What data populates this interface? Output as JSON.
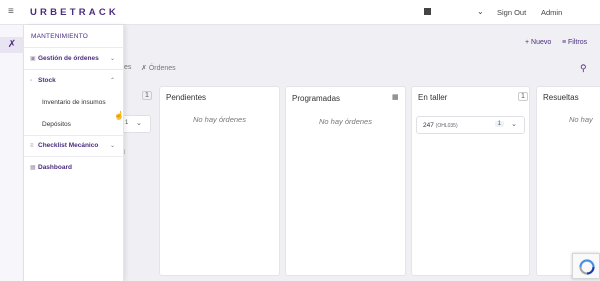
{
  "app": {
    "brand": "URBETRACK",
    "sign_out": "Sign Out",
    "user": "Admin"
  },
  "menu": {
    "header": "MANTENIMIENTO",
    "items": [
      {
        "label": "Gestión de órdenes",
        "icon": "truck-icon"
      },
      {
        "label": "Stock",
        "icon": "box-icon"
      },
      {
        "label": "Checklist Mecánico",
        "icon": "list-icon"
      },
      {
        "label": "Dashboard",
        "icon": "dashboard-icon"
      }
    ],
    "stock_sub": [
      "Inventario de insumos",
      "Depósitos"
    ]
  },
  "toolbar": {
    "nuevo": "Nuevo",
    "filtros": "Filtros",
    "tab_partial": "es",
    "tab_ordenes": "Órdenes"
  },
  "columns": {
    "partial_count": "1",
    "partial_badge": "1",
    "partial_mark": "l",
    "pendientes": {
      "title": "Pendientes",
      "empty": "No hay órdenes"
    },
    "programadas": {
      "title": "Programadas",
      "empty": "No hay órdenes"
    },
    "en_taller": {
      "title": "En taller",
      "count": "1",
      "card_id": "247",
      "card_plate": "(OHL035)",
      "card_badge": "1"
    },
    "resueltas": {
      "title": "Resueltas",
      "empty": "No hay"
    }
  },
  "colors": {
    "brand": "#4b2d7f",
    "background": "#f0eff3"
  }
}
